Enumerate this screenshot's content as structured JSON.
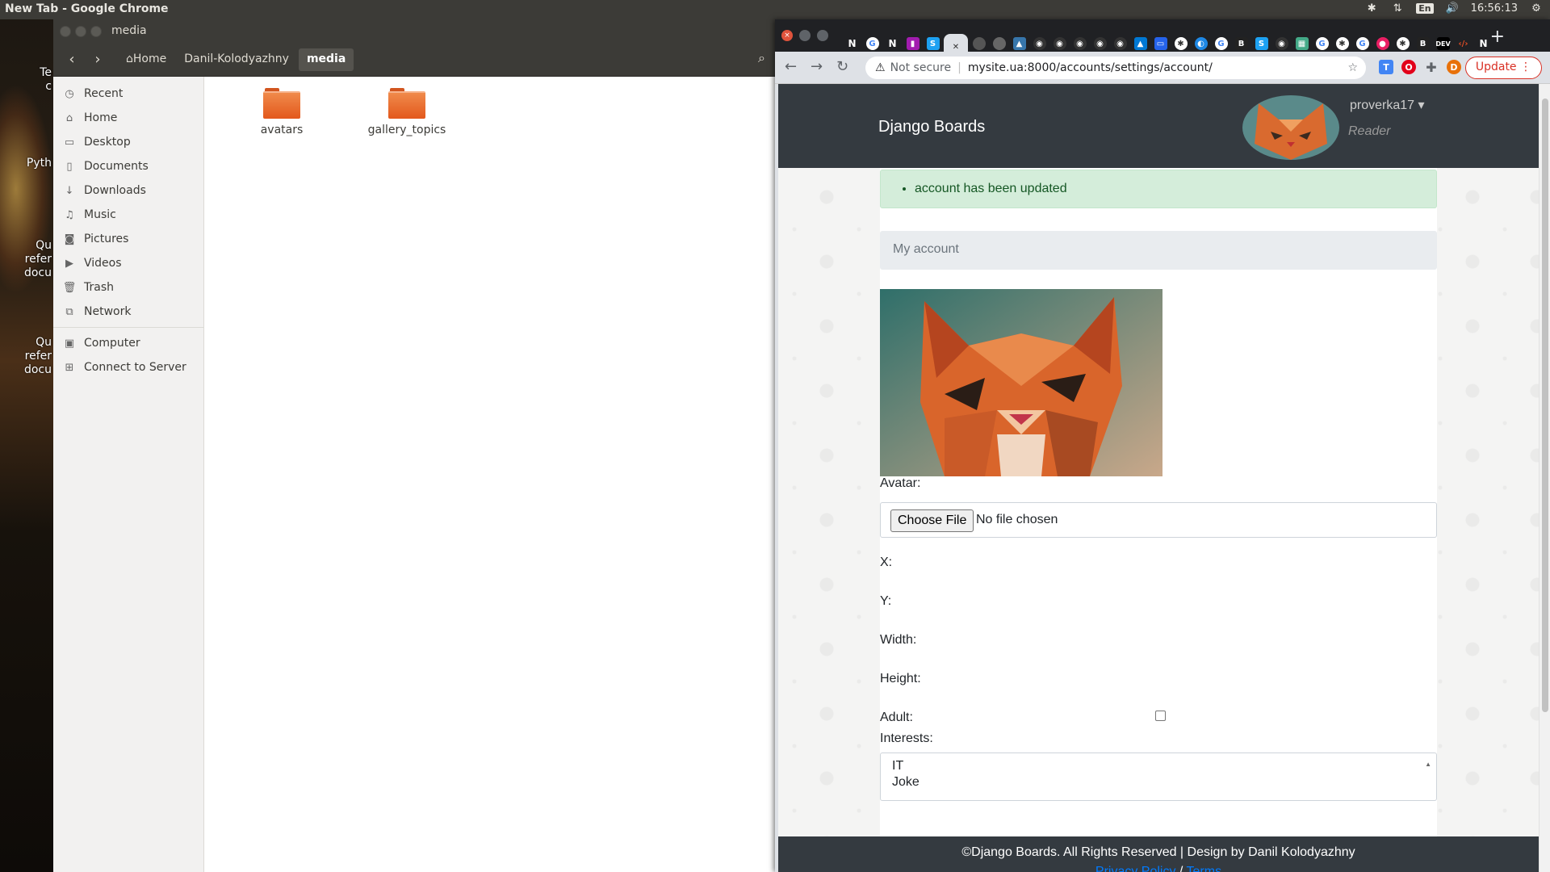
{
  "topbar": {
    "title": "New Tab - Google Chrome",
    "lang": "En",
    "time": "16:56:13"
  },
  "desktop": {
    "texts": [
      "Te\nc",
      "Pyth",
      "Qu\nrefer\ndocu",
      "Qu\nrefer\ndocu"
    ]
  },
  "nautilus": {
    "title": "media",
    "breadcrumbs": [
      "Home",
      "Danil-Kolodyazhny",
      "media"
    ],
    "sidebar": [
      {
        "label": "Recent",
        "icon": "clock-icon"
      },
      {
        "label": "Home",
        "icon": "home-icon"
      },
      {
        "label": "Desktop",
        "icon": "folder-icon"
      },
      {
        "label": "Documents",
        "icon": "document-icon"
      },
      {
        "label": "Downloads",
        "icon": "download-icon"
      },
      {
        "label": "Music",
        "icon": "music-icon"
      },
      {
        "label": "Pictures",
        "icon": "camera-icon"
      },
      {
        "label": "Videos",
        "icon": "video-icon"
      },
      {
        "label": "Trash",
        "icon": "trash-icon"
      },
      {
        "label": "Network",
        "icon": "network-icon"
      },
      {
        "label": "Computer",
        "icon": "computer-icon"
      },
      {
        "label": "Connect to Server",
        "icon": "server-icon"
      }
    ],
    "files": [
      "avatars",
      "gallery_topics"
    ]
  },
  "chrome": {
    "url_warning": "Not secure",
    "url": "mysite.ua:8000/accounts/settings/account/",
    "update_label": "Update",
    "profile_initial": "D"
  },
  "page": {
    "brand": "Django Boards",
    "username": "proverka17",
    "role": "Reader",
    "alert": "account has been updated",
    "card_header": "My account",
    "labels": {
      "avatar": "Avatar:",
      "x": "X:",
      "y": "Y:",
      "width": "Width:",
      "height": "Height:",
      "adult": "Adult:",
      "interests": "Interests:"
    },
    "file_button": "Choose File",
    "file_status": "No file chosen",
    "interests": [
      "IT",
      "Joke"
    ],
    "footer_text": "©Django Boards. All Rights Reserved | Design by Danil Kolodyazhny",
    "footer_privacy": "Privacy Policy",
    "footer_sep": "/",
    "footer_terms": "Terms"
  }
}
